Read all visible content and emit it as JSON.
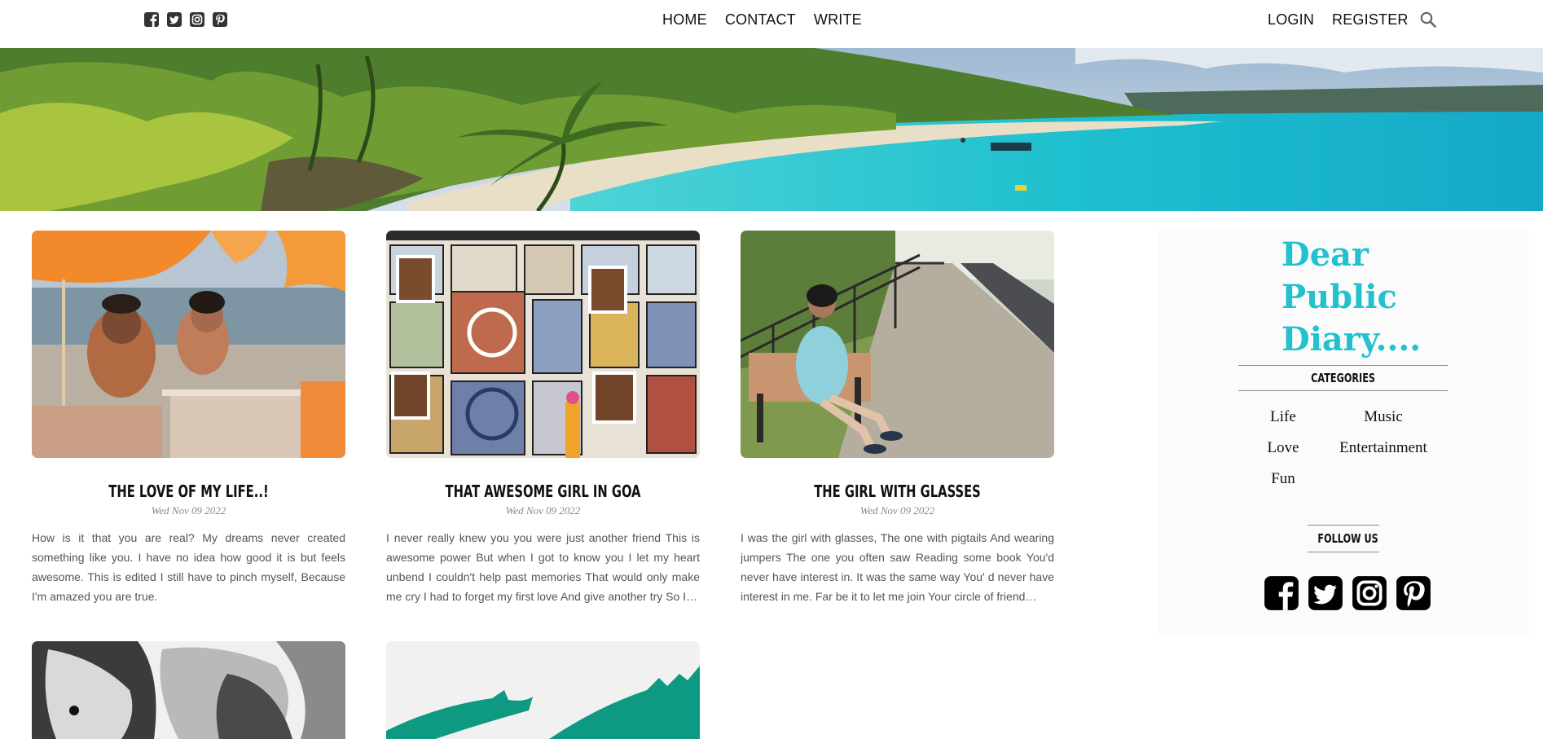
{
  "nav": {
    "home": "HOME",
    "contact": "CONTACT",
    "write": "WRITE",
    "login": "LOGIN",
    "register": "REGISTER"
  },
  "social_icons": [
    "facebook-icon",
    "twitter-icon",
    "instagram-icon",
    "pinterest-icon"
  ],
  "posts": [
    {
      "title": "The Love of My Life..!",
      "date": "Wed Nov 09 2022",
      "excerpt": "How is it that you are real? My dreams never created something like you. I have no idea how good it is but feels awesome. This is edited I still have to pinch myself, Because I'm amazed you are true."
    },
    {
      "title": "That Awesome Girl in Goa",
      "date": "Wed Nov 09 2022",
      "excerpt": "I never really knew you you were just another friend This is awesome power But when I got to know you I let my heart unbend I couldn't help past memories That would only make me cry I had to forget my first love And give another try So I…"
    },
    {
      "title": "The Girl with Glasses",
      "date": "Wed Nov 09 2022",
      "excerpt": "I was the girl with glasses, The one with pigtails And wearing jumpers The one you often saw Reading some book You'd never have interest in. It was the same way You' d never have interest in me. Far be it to let me join Your circle of friend…"
    }
  ],
  "sidebar": {
    "title_lines": [
      "Dear",
      "Public",
      "Diary...."
    ],
    "categories_heading": "CATEGORIES",
    "categories": [
      "Life",
      "Music",
      "Love",
      "Entertainment",
      "Fun"
    ],
    "follow_heading": "FOLLOW US"
  },
  "colors": {
    "accent": "#22c1cf",
    "sidebar_bg": "#fcfbfb",
    "text": "#111111"
  }
}
